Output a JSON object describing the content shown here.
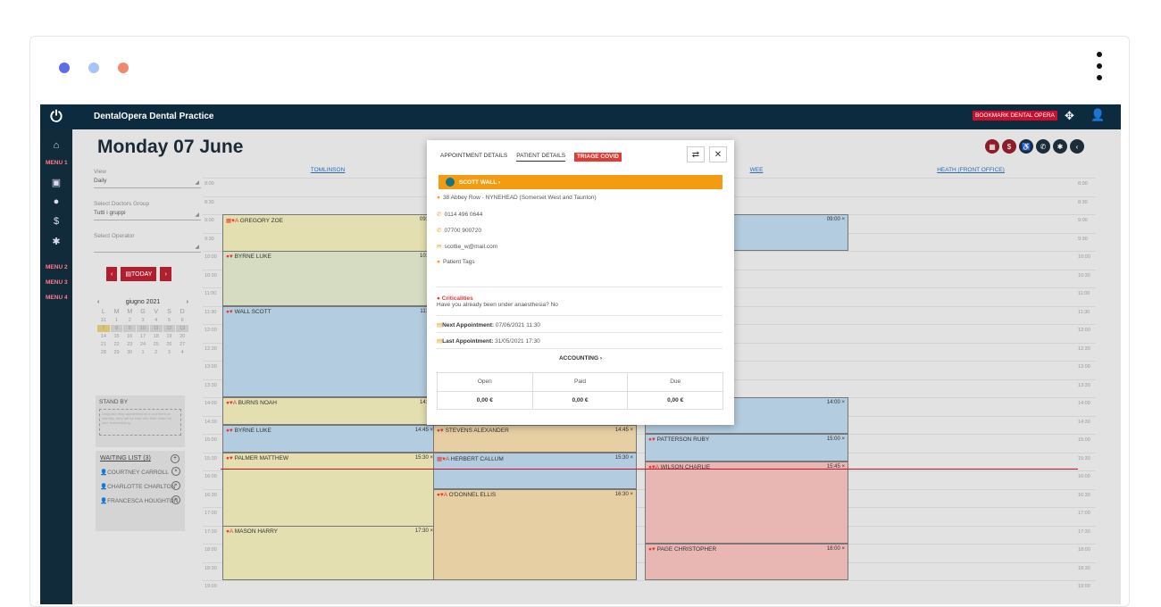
{
  "window": {
    "dot_colors": [
      "#5b6ee8",
      "#a8c4ff",
      "#f08a6e"
    ]
  },
  "topbar": {
    "title": "DentalOpera Dental Practice",
    "bookmark": "BOOKMARK DENTAL OPERA"
  },
  "sidebar": {
    "menus": [
      "MENU 1",
      "MENU 2",
      "MENU 3",
      "MENU 4"
    ]
  },
  "page": {
    "title": "Monday 07 June"
  },
  "filters": {
    "view_label": "View",
    "view_value": "Daily",
    "doctors_label": "Select Doctors Group",
    "doctors_value": "Tutti i gruppi",
    "operator_label": "Select Operator",
    "operator_value": ""
  },
  "datenav": {
    "prev": "‹",
    "today": "TODAY",
    "next": "›"
  },
  "mini_calendar": {
    "month": "giugno 2021",
    "dow": [
      "L",
      "M",
      "M",
      "G",
      "V",
      "S",
      "D"
    ],
    "weeks": [
      [
        "31",
        "1",
        "2",
        "3",
        "4",
        "5",
        "6"
      ],
      [
        "7",
        "8",
        "9",
        "10",
        "11",
        "12",
        "13"
      ],
      [
        "14",
        "15",
        "16",
        "17",
        "18",
        "19",
        "20"
      ],
      [
        "21",
        "22",
        "23",
        "24",
        "25",
        "26",
        "27"
      ],
      [
        "28",
        "29",
        "30",
        "1",
        "2",
        "3",
        "4"
      ]
    ]
  },
  "standby": {
    "title": "STAND BY",
    "hint": "Drag and drop appointments to put them on standby, they will be kept with their notes for later rescheduling."
  },
  "waiting_list": {
    "title": "WAITING LIST (3)",
    "items": [
      "COURTNEY CARROLL",
      "CHARLOTTE CHARLTON",
      "FRANCESCA HOUGHTON"
    ]
  },
  "calendar": {
    "columns": [
      "TOMLINSON",
      "WEE",
      "HEATH (FRONT OFFICE)"
    ],
    "times": [
      "8:00",
      "8:30",
      "9:00",
      "9:30",
      "10:00",
      "10:30",
      "11:00",
      "11:30",
      "12:00",
      "12:30",
      "13:00",
      "13:30",
      "14:00",
      "14:30",
      "15:00",
      "15:30",
      "16:00",
      "16:30",
      "17:00",
      "17:30",
      "18:00",
      "18:30",
      "19:00"
    ],
    "appointments": [
      {
        "name": "GREGORY ZOE",
        "time": "09:00"
      },
      {
        "name": "BYRNE LUKE",
        "time": "10:00"
      },
      {
        "name": "WALL SCOTT",
        "time": "11:30"
      },
      {
        "name": "BURNS NOAH",
        "time": "14:00"
      },
      {
        "name": "BYRNE LUKE",
        "time": "14:45 ×"
      },
      {
        "name": "PALMER MATTHEW",
        "time": "15:30 ×"
      },
      {
        "name": "MASON HARRY",
        "time": "17:30 ×"
      },
      {
        "name": "STEVENS ALEXANDER",
        "time": "14:45 ×"
      },
      {
        "name": "HERBERT CALLUM",
        "time": "15:30 ×"
      },
      {
        "name": "O'DONNEL ELLIS",
        "time": "16:30 ×"
      },
      {
        "name": "",
        "time": "09:00 ×"
      },
      {
        "name": "",
        "time": "14:00 ×"
      },
      {
        "name": "PATTERSON RUBY",
        "time": "15:00 ×"
      },
      {
        "name": "WILSON CHARLIE",
        "time": "15:45 ×"
      },
      {
        "name": "PAGE CHRISTOPHER",
        "time": "18:00 ×"
      }
    ]
  },
  "modal": {
    "tabs": [
      "APPOINTMENT DETAILS",
      "PATIENT DETAILS",
      "TRIAGE COVID"
    ],
    "patient": "SCOTT WALL",
    "address": "38 Abbey Row - NYNEHEAD (Somerset West and Taunton)",
    "phone1": "0114 496 0644",
    "phone2": "07700 900720",
    "email": "scottie_w@mail.com",
    "tags": "Patient Tags",
    "crit_title": "Criticalities",
    "crit_text": "Have you already been under anaesthesia? No",
    "next_label": "Next Appointment:",
    "next_value": "07/06/2021 11:30",
    "last_label": "Last Appointment:",
    "last_value": "31/05/2021 17:30",
    "accounting": "ACCOUNTING",
    "table_headers": [
      "Open",
      "Paid",
      "Due"
    ],
    "table_values": [
      "0,00 €",
      "0,00 €",
      "0,00 €"
    ]
  }
}
